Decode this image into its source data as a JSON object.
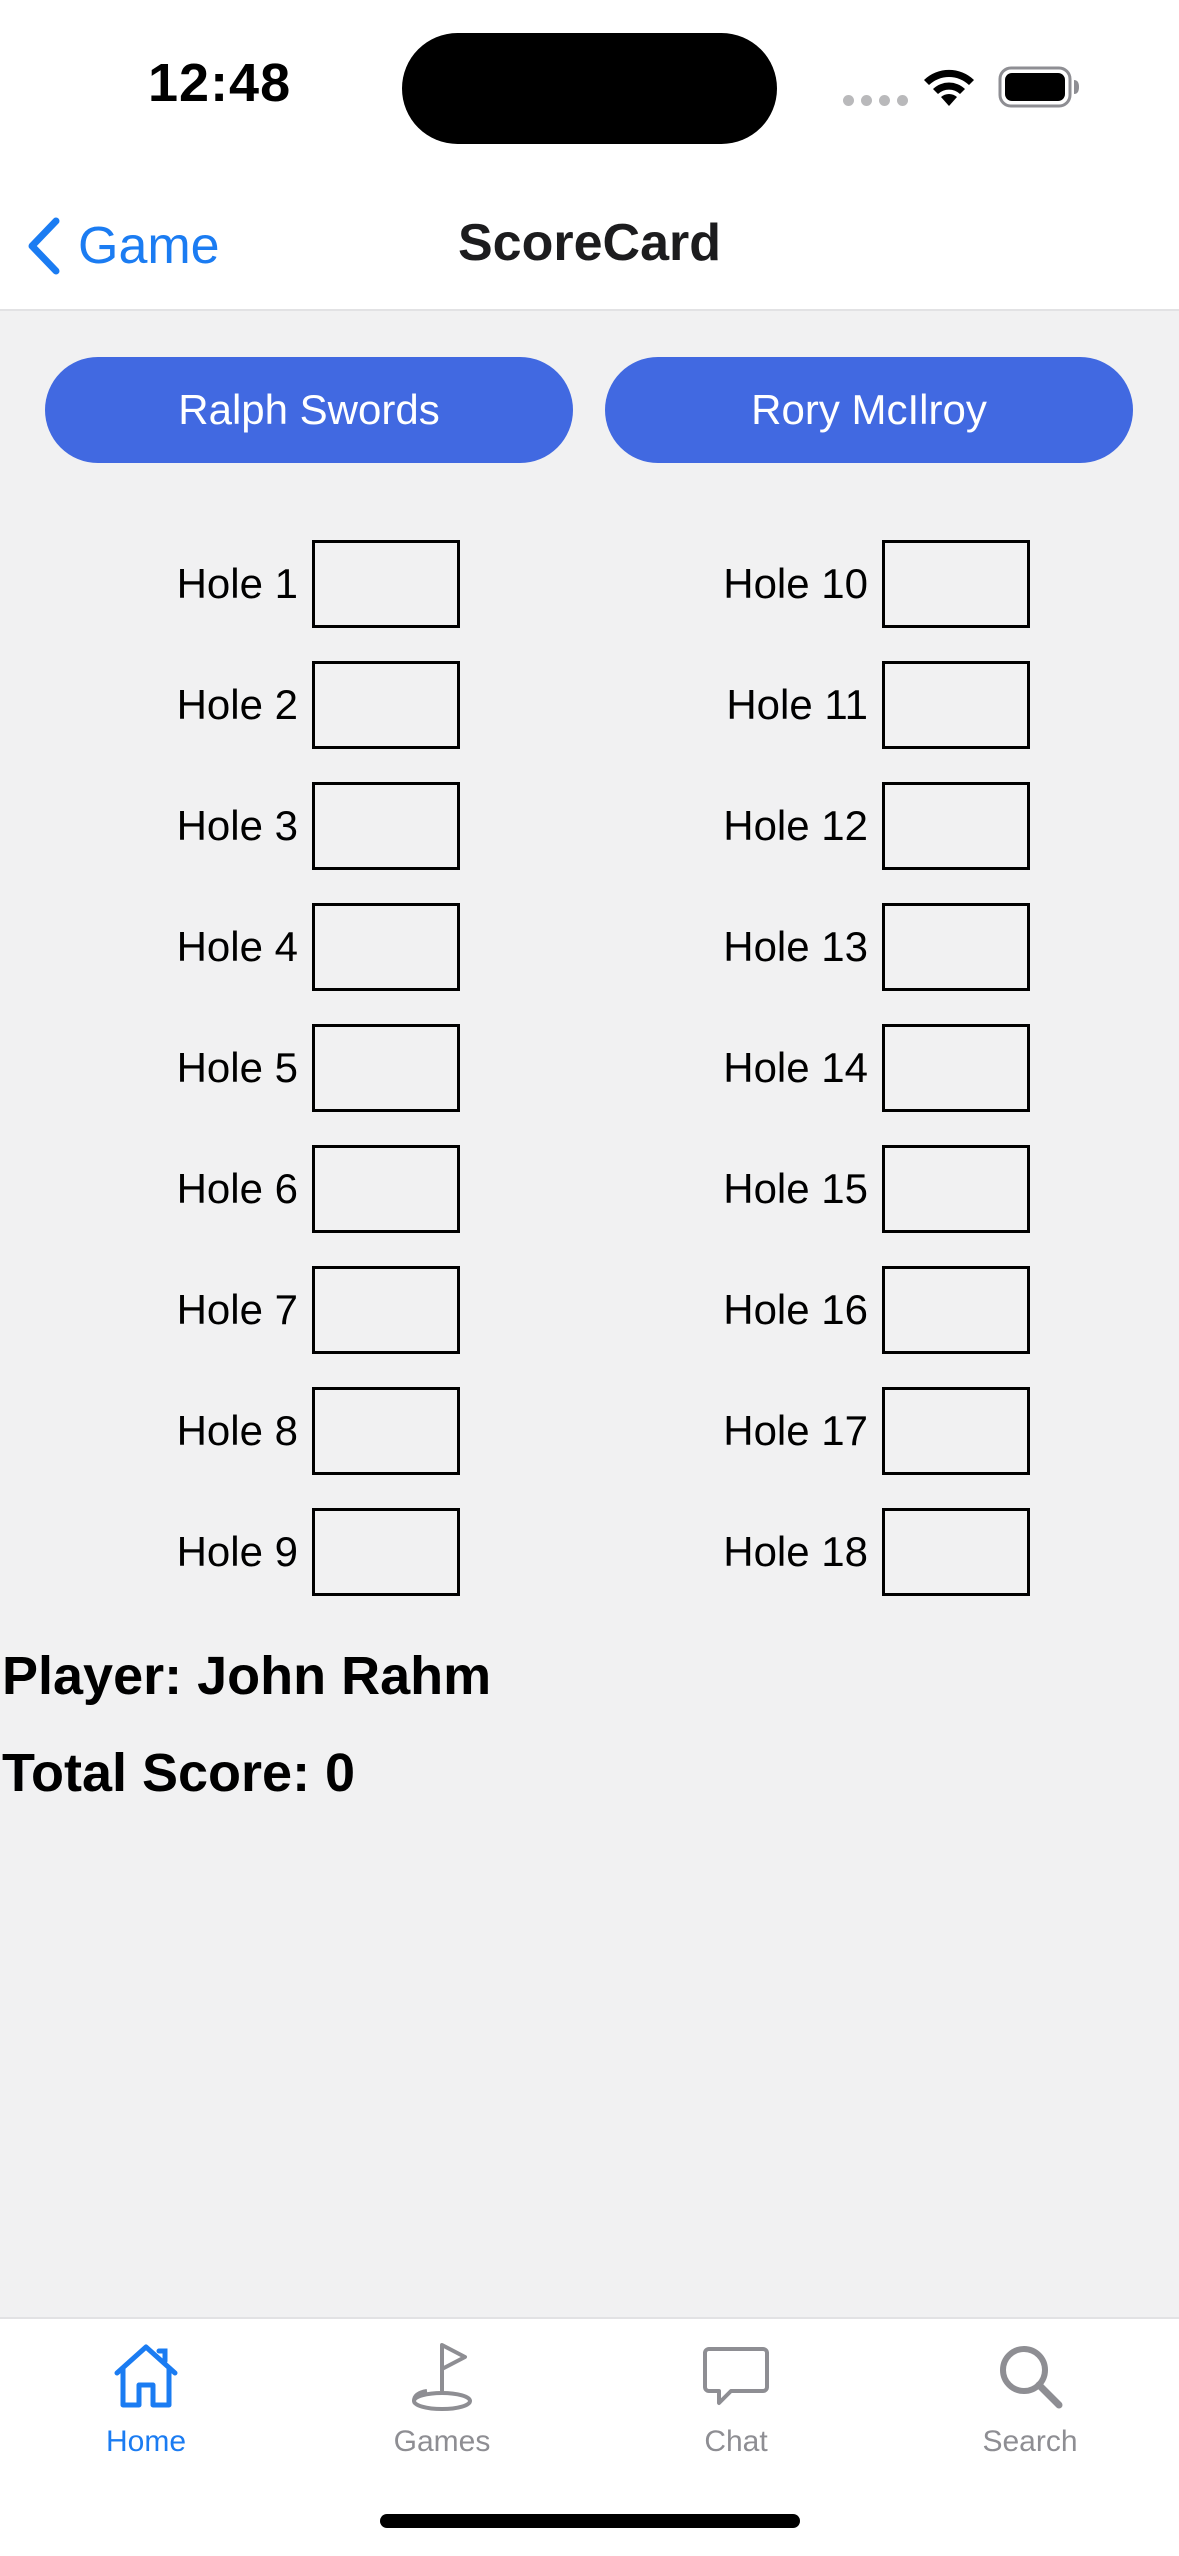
{
  "status_bar": {
    "time": "12:48"
  },
  "nav": {
    "back_label": "Game",
    "title": "ScoreCard"
  },
  "players": {
    "left": "Ralph Swords",
    "right": "Rory McIlroy"
  },
  "holes_front": [
    {
      "label": "Hole 1",
      "value": ""
    },
    {
      "label": "Hole 2",
      "value": ""
    },
    {
      "label": "Hole 3",
      "value": ""
    },
    {
      "label": "Hole 4",
      "value": ""
    },
    {
      "label": "Hole 5",
      "value": ""
    },
    {
      "label": "Hole 6",
      "value": ""
    },
    {
      "label": "Hole 7",
      "value": ""
    },
    {
      "label": "Hole 8",
      "value": ""
    },
    {
      "label": "Hole 9",
      "value": ""
    }
  ],
  "holes_back": [
    {
      "label": "Hole 10",
      "value": ""
    },
    {
      "label": "Hole 11",
      "value": ""
    },
    {
      "label": "Hole 12",
      "value": ""
    },
    {
      "label": "Hole 13",
      "value": ""
    },
    {
      "label": "Hole 14",
      "value": ""
    },
    {
      "label": "Hole 15",
      "value": ""
    },
    {
      "label": "Hole 16",
      "value": ""
    },
    {
      "label": "Hole 17",
      "value": ""
    },
    {
      "label": "Hole 18",
      "value": ""
    }
  ],
  "summary": {
    "player_line": "Player: John Rahm",
    "total_line": "Total Score: 0"
  },
  "tabs": [
    {
      "label": "Home",
      "icon": "house-icon",
      "active": true
    },
    {
      "label": "Games",
      "icon": "golf-flag-icon",
      "active": false
    },
    {
      "label": "Chat",
      "icon": "chat-bubble-icon",
      "active": false
    },
    {
      "label": "Search",
      "icon": "magnifier-icon",
      "active": false
    }
  ],
  "colors": {
    "accent": "#1b7cf2",
    "player_button": "#4169e1",
    "inactive_tab": "#8e8e93",
    "background": "#f1f1f2"
  }
}
